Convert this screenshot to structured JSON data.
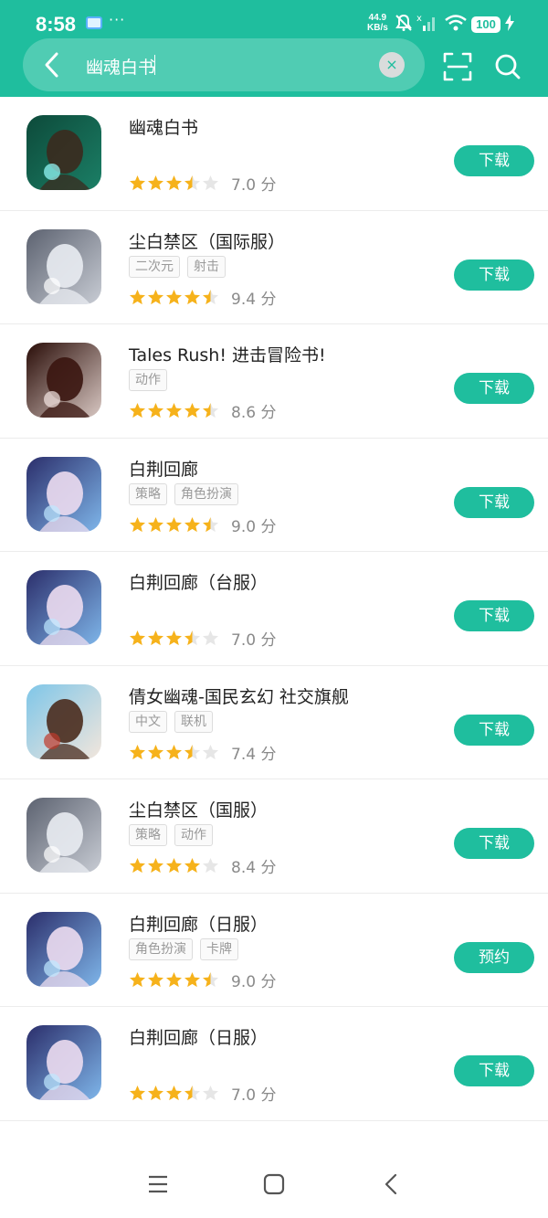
{
  "status_bar": {
    "time": "8:58",
    "more": "···",
    "speed_value": "44.9",
    "speed_unit": "KB/s",
    "battery": "100"
  },
  "search": {
    "value": "幽魂白书"
  },
  "header_icons": [
    "back-icon",
    "clear-icon",
    "scan-icon",
    "search-icon"
  ],
  "accent_color": "#1fbe9e",
  "results": [
    {
      "name": "幽魂白书",
      "tags": [],
      "stars": 3.5,
      "score": "7.0 分",
      "button": "下载"
    },
    {
      "name": "尘白禁区（国际服）",
      "tags": [
        "二次元",
        "射击"
      ],
      "stars": 4.5,
      "score": "9.4 分",
      "button": "下载"
    },
    {
      "name": "Tales Rush! 进击冒险书!",
      "tags": [
        "动作"
      ],
      "stars": 4.5,
      "score": "8.6 分",
      "button": "下载"
    },
    {
      "name": "白荆回廊",
      "tags": [
        "策略",
        "角色扮演"
      ],
      "stars": 4.5,
      "score": "9.0 分",
      "button": "下载"
    },
    {
      "name": "白荆回廊（台服）",
      "tags": [],
      "stars": 3.5,
      "score": "7.0 分",
      "button": "下载"
    },
    {
      "name": "倩女幽魂-国民玄幻 社交旗舰",
      "tags": [
        "中文",
        "联机"
      ],
      "stars": 3.5,
      "score": "7.4 分",
      "button": "下载"
    },
    {
      "name": "尘白禁区（国服）",
      "tags": [
        "策略",
        "动作"
      ],
      "stars": 4,
      "score": "8.4 分",
      "button": "下载"
    },
    {
      "name": "白荆回廊（日服）",
      "tags": [
        "角色扮演",
        "卡牌"
      ],
      "stars": 4.5,
      "score": "9.0 分",
      "button": "预约"
    },
    {
      "name": "白荆回廊（日服）",
      "tags": [],
      "stars": 3.5,
      "score": "7.0 分",
      "button": "下载"
    }
  ],
  "nav_icons": [
    "menu-icon",
    "home-icon",
    "back-icon"
  ]
}
